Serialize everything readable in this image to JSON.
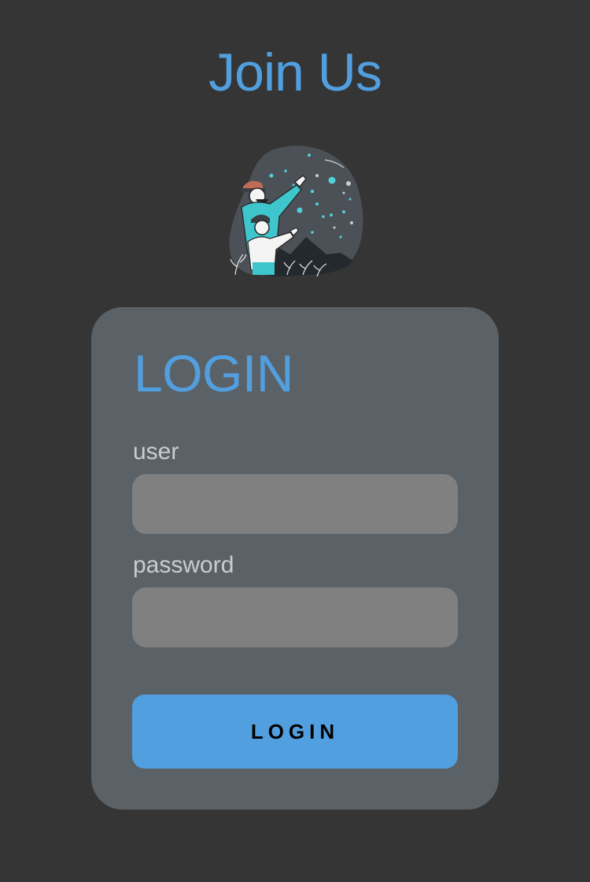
{
  "header": {
    "title": "Join Us"
  },
  "illustration": {
    "icon": "stargazing-illustration"
  },
  "login_card": {
    "title": "LOGIN",
    "user": {
      "label": "user",
      "value": "",
      "placeholder": ""
    },
    "password": {
      "label": "password",
      "value": "",
      "placeholder": ""
    },
    "submit_label": "LOGIN"
  },
  "colors": {
    "background": "#353535",
    "card": "#5b6267",
    "accent": "#529fe0",
    "input": "#808080",
    "label": "#c9cdd0"
  }
}
